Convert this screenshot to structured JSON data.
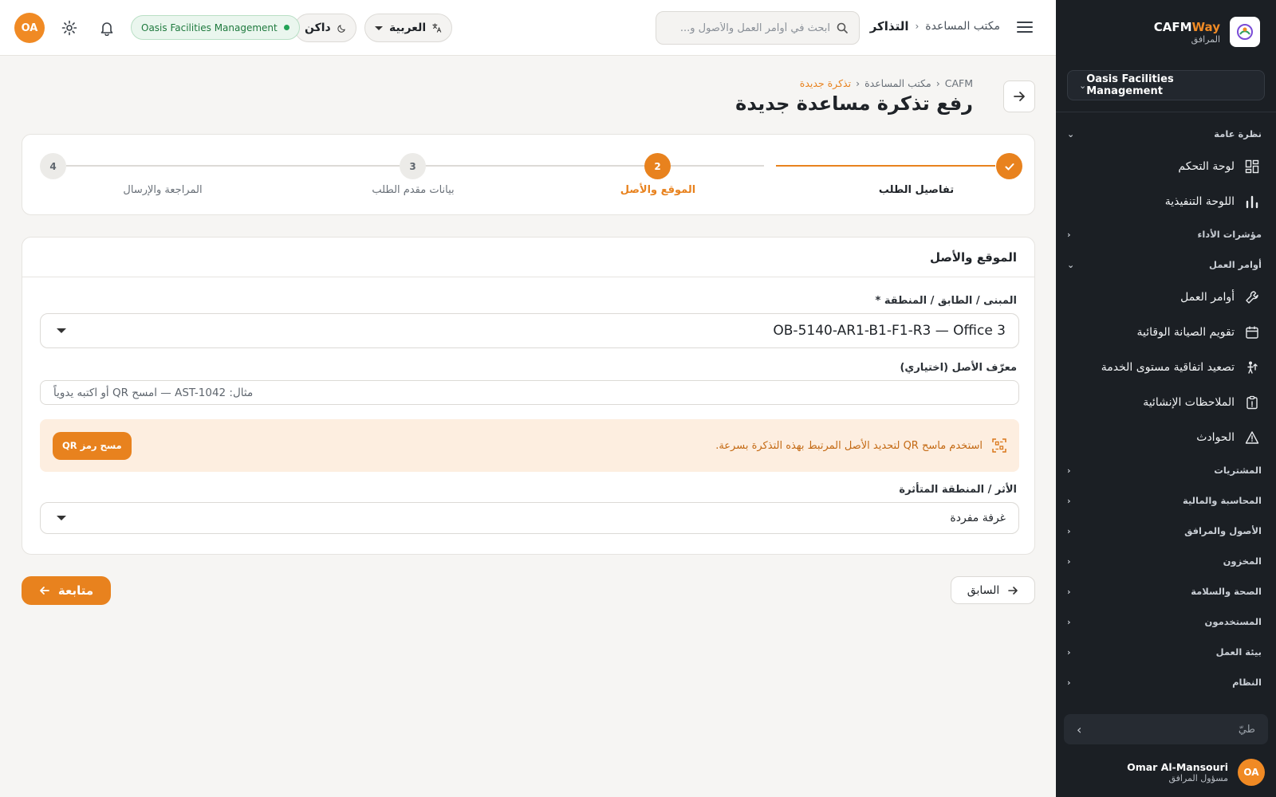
{
  "brand": {
    "name_a": "CAFM",
    "name_b": "Way",
    "subtitle": "المرافق"
  },
  "sidebar": {
    "org_selector": "Oasis Facilities Management",
    "groups": [
      {
        "label": "نظرة عامة",
        "expanded": true,
        "items": [
          {
            "label": "لوحة التحكم",
            "icon": "dashboard-icon"
          },
          {
            "label": "اللوحة التنفيذية",
            "icon": "bar-chart-icon"
          }
        ]
      },
      {
        "label": "مؤشرات الأداء",
        "expanded": false
      },
      {
        "label": "أوامر العمل",
        "expanded": true,
        "items": [
          {
            "label": "أوامر العمل",
            "icon": "wrench-icon"
          },
          {
            "label": "تقويم الصيانة الوقائية",
            "icon": "calendar-icon"
          },
          {
            "label": "تصعيد اتفاقية مستوى الخدمة",
            "icon": "escalation-icon"
          },
          {
            "label": "الملاحظات الإنشائية",
            "icon": "clipboard-icon"
          },
          {
            "label": "الحوادث",
            "icon": "warning-icon"
          }
        ]
      },
      {
        "label": "المشتريات"
      },
      {
        "label": "المحاسبة والمالية"
      },
      {
        "label": "الأصول والمرافق"
      },
      {
        "label": "المخزون"
      },
      {
        "label": "الصحة والسلامة"
      },
      {
        "label": "المستخدمون"
      },
      {
        "label": "بيئة العمل"
      },
      {
        "label": "النظام"
      }
    ],
    "search_placeholder": "طيّ",
    "user": {
      "initials": "OA",
      "name": "Omar Al-Mansouri",
      "role": "مسؤول المرافق"
    }
  },
  "topbar": {
    "breadcrumb_root": "مكتب المساعدة",
    "breadcrumb_current": "التذاكر",
    "search_placeholder": "ابحث في أوامر العمل والأصول و...",
    "language": "العربية",
    "theme": "داكن",
    "org_badge": "Oasis Facilities Management",
    "avatar": "OA"
  },
  "page": {
    "breadcrumb": [
      "CAFM",
      "مكتب المساعدة",
      "تذكرة جديدة"
    ],
    "title": "رفع تذكرة مساعدة جديدة"
  },
  "stepper": {
    "steps": [
      {
        "number": "1",
        "label": "تفاصيل الطلب",
        "state": "done"
      },
      {
        "number": "2",
        "label": "الموقع والأصل",
        "state": "active"
      },
      {
        "number": "3",
        "label": "بيانات مقدم الطلب",
        "state": "todo"
      },
      {
        "number": "4",
        "label": "المراجعة والإرسال",
        "state": "todo"
      }
    ]
  },
  "form": {
    "section_title": "الموقع والأصل",
    "location_label": "المبنى / الطابق / المنطقة *",
    "location_value": "OB-5140-AR1-B1-F1-R3 — Office 3",
    "asset_label": "معرّف الأصل (اختياري)",
    "asset_placeholder": "مثال: AST-1042 — امسح QR أو اكتبه يدوياً",
    "qr_message": "استخدم ماسح QR لتحديد الأصل المرتبط بهذه التذكرة بسرعة.",
    "qr_button": "مسح رمز QR",
    "impact_label": "الأثر / المنطقة المتأثرة",
    "impact_value": "غرفة مفردة"
  },
  "actions": {
    "previous": "السابق",
    "next": "متابعة"
  },
  "colors": {
    "accent": "#e8821e",
    "sidebar_bg": "#1b1f24",
    "success": "#22a356"
  }
}
